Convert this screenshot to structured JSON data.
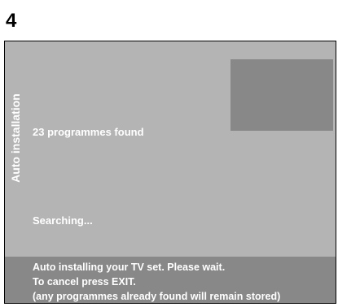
{
  "step": "4",
  "screen": {
    "side_title": "Auto installation",
    "programmes_found": "23 programmes found",
    "status": "Searching...",
    "info": [
      "Auto installing your TV set. Please wait.",
      "To cancel press EXIT.",
      "(any programmes already found will remain stored)"
    ]
  },
  "colors": {
    "screen_background": "#b4b4b4",
    "panel_dark": "#888888",
    "text": "#ffffff"
  }
}
